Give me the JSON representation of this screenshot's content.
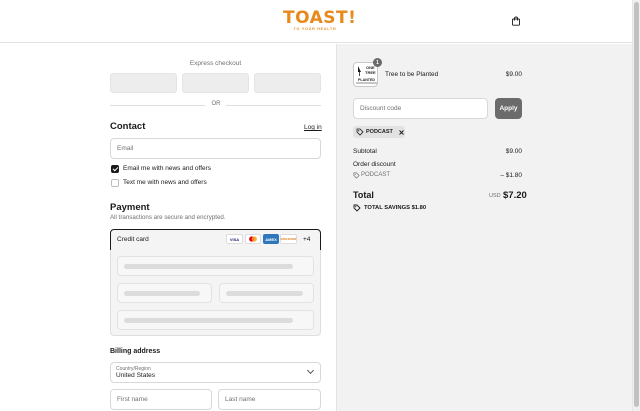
{
  "header": {
    "logo_text": "TOAST!",
    "logo_tagline": "TO YOUR HEALTH",
    "cart_icon": "shopping-bag-icon"
  },
  "express": {
    "label": "Express checkout",
    "or_label": "OR"
  },
  "contact": {
    "heading": "Contact",
    "login_link": "Log in",
    "email_placeholder": "Email",
    "news_offers_label": "Email me with news and offers",
    "news_offers_checked": true,
    "text_offers_label": "Text me with news and offers",
    "text_offers_checked": false
  },
  "payment": {
    "heading": "Payment",
    "subtitle": "All transactions are secure and encrypted.",
    "method_label": "Credit card",
    "cards": [
      "VISA",
      "mastercard",
      "AMEX",
      "DISCOVER"
    ],
    "more_cards": "+4"
  },
  "billing": {
    "heading": "Billing address",
    "country_label": "Country/Region",
    "country_value": "United States",
    "first_name_placeholder": "First name",
    "last_name_placeholder": "Last name"
  },
  "order": {
    "item": {
      "image_text": [
        "ONE",
        "TREE",
        "PLANTED"
      ],
      "quantity": "1",
      "name": "Tree to be Planted",
      "price": "$9.00"
    },
    "discount_placeholder": "Discount code",
    "apply_label": "Apply",
    "applied_code": "PODCAST",
    "subtotal_label": "Subtotal",
    "subtotal_value": "$9.00",
    "order_discount_label": "Order discount",
    "discount_code": "PODCAST",
    "discount_value": "– $1.80",
    "total_label": "Total",
    "currency": "USD",
    "total_value": "$7.20",
    "savings_label": "TOTAL SAVINGS",
    "savings_value": "$1.80"
  },
  "colors": {
    "brand": "#e8891c",
    "apply_button": "#6b6b6b",
    "summary_bg": "#f2f2f2"
  }
}
